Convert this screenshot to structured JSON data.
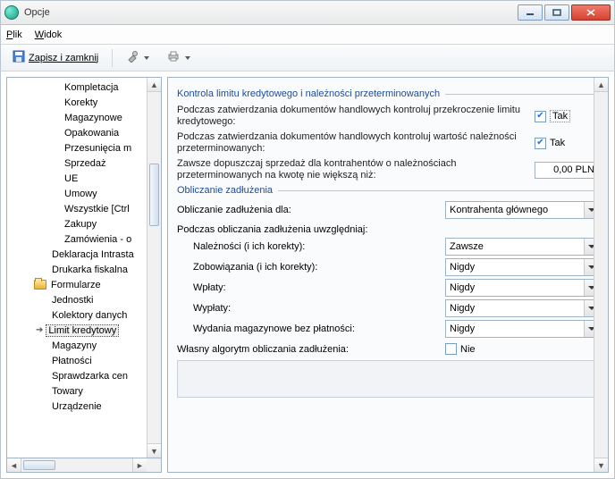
{
  "window": {
    "title": "Opcje"
  },
  "menu": {
    "file": "Plik",
    "view": "Widok"
  },
  "toolbar": {
    "save_close": "Zapisz i zamknij"
  },
  "tree": {
    "items": [
      {
        "label": "Kompletacja",
        "icon": null
      },
      {
        "label": "Korekty",
        "icon": null
      },
      {
        "label": "Magazynowe",
        "icon": null
      },
      {
        "label": "Opakowania",
        "icon": null
      },
      {
        "label": "Przesunięcia m",
        "icon": null
      },
      {
        "label": "Sprzedaż",
        "icon": null
      },
      {
        "label": "UE",
        "icon": null
      },
      {
        "label": "Umowy",
        "icon": null
      },
      {
        "label": "Wszystkie [Ctrl",
        "icon": null
      },
      {
        "label": "Zakupy",
        "icon": null
      },
      {
        "label": "Zamówienia - o",
        "icon": null
      },
      {
        "label": "Deklaracja Intrasta",
        "icon": null,
        "indent": 0
      },
      {
        "label": "Drukarka fiskalna",
        "icon": null,
        "indent": 0
      },
      {
        "label": "Formularze",
        "icon": "folder",
        "indent": 0
      },
      {
        "label": "Jednostki",
        "icon": null,
        "indent": 0
      },
      {
        "label": "Kolektory danych",
        "icon": null,
        "indent": 0
      },
      {
        "label": "Limit kredytowy",
        "icon": "arrow",
        "indent": 0,
        "selected": true
      },
      {
        "label": "Magazyny",
        "icon": null,
        "indent": 0
      },
      {
        "label": "Płatności",
        "icon": null,
        "indent": 0
      },
      {
        "label": "Sprawdzarka cen",
        "icon": null,
        "indent": 0
      },
      {
        "label": "Towary",
        "icon": null,
        "indent": 0
      },
      {
        "label": "Urządzenie",
        "icon": null,
        "indent": 0
      }
    ]
  },
  "panel": {
    "group1_title": "Kontrola limitu kredytowego i należności przeterminowanych",
    "row1_label": "Podczas zatwierdzania dokumentów handlowych kontroluj przekroczenie limitu kredytowego:",
    "row1_value": "Tak",
    "row1_checked": true,
    "row2_label": "Podczas zatwierdzania dokumentów handlowych kontroluj wartość należności przeterminowanych:",
    "row2_value": "Tak",
    "row2_checked": true,
    "row3_label": "Zawsze dopuszczaj sprzedaż dla kontrahentów o należnościach przeterminowanych na kwotę nie większą niż:",
    "row3_value": "0,00 PLN",
    "group2_title": "Obliczanie zadłużenia",
    "calc_for_label": "Obliczanie zadłużenia dla:",
    "calc_for_value": "Kontrahenta głównego",
    "consider_label": "Podczas obliczania zadłużenia uwzględniaj:",
    "items": [
      {
        "label": "Należności (i ich korekty):",
        "value": "Zawsze"
      },
      {
        "label": "Zobowiązania (i ich korekty):",
        "value": "Nigdy"
      },
      {
        "label": "Wpłaty:",
        "value": "Nigdy"
      },
      {
        "label": "Wypłaty:",
        "value": "Nigdy"
      },
      {
        "label": "Wydania magazynowe bez płatności:",
        "value": "Nigdy"
      }
    ],
    "own_algo_label": "Własny algorytm obliczania zadłużenia:",
    "own_algo_value": "Nie",
    "own_algo_checked": false
  }
}
